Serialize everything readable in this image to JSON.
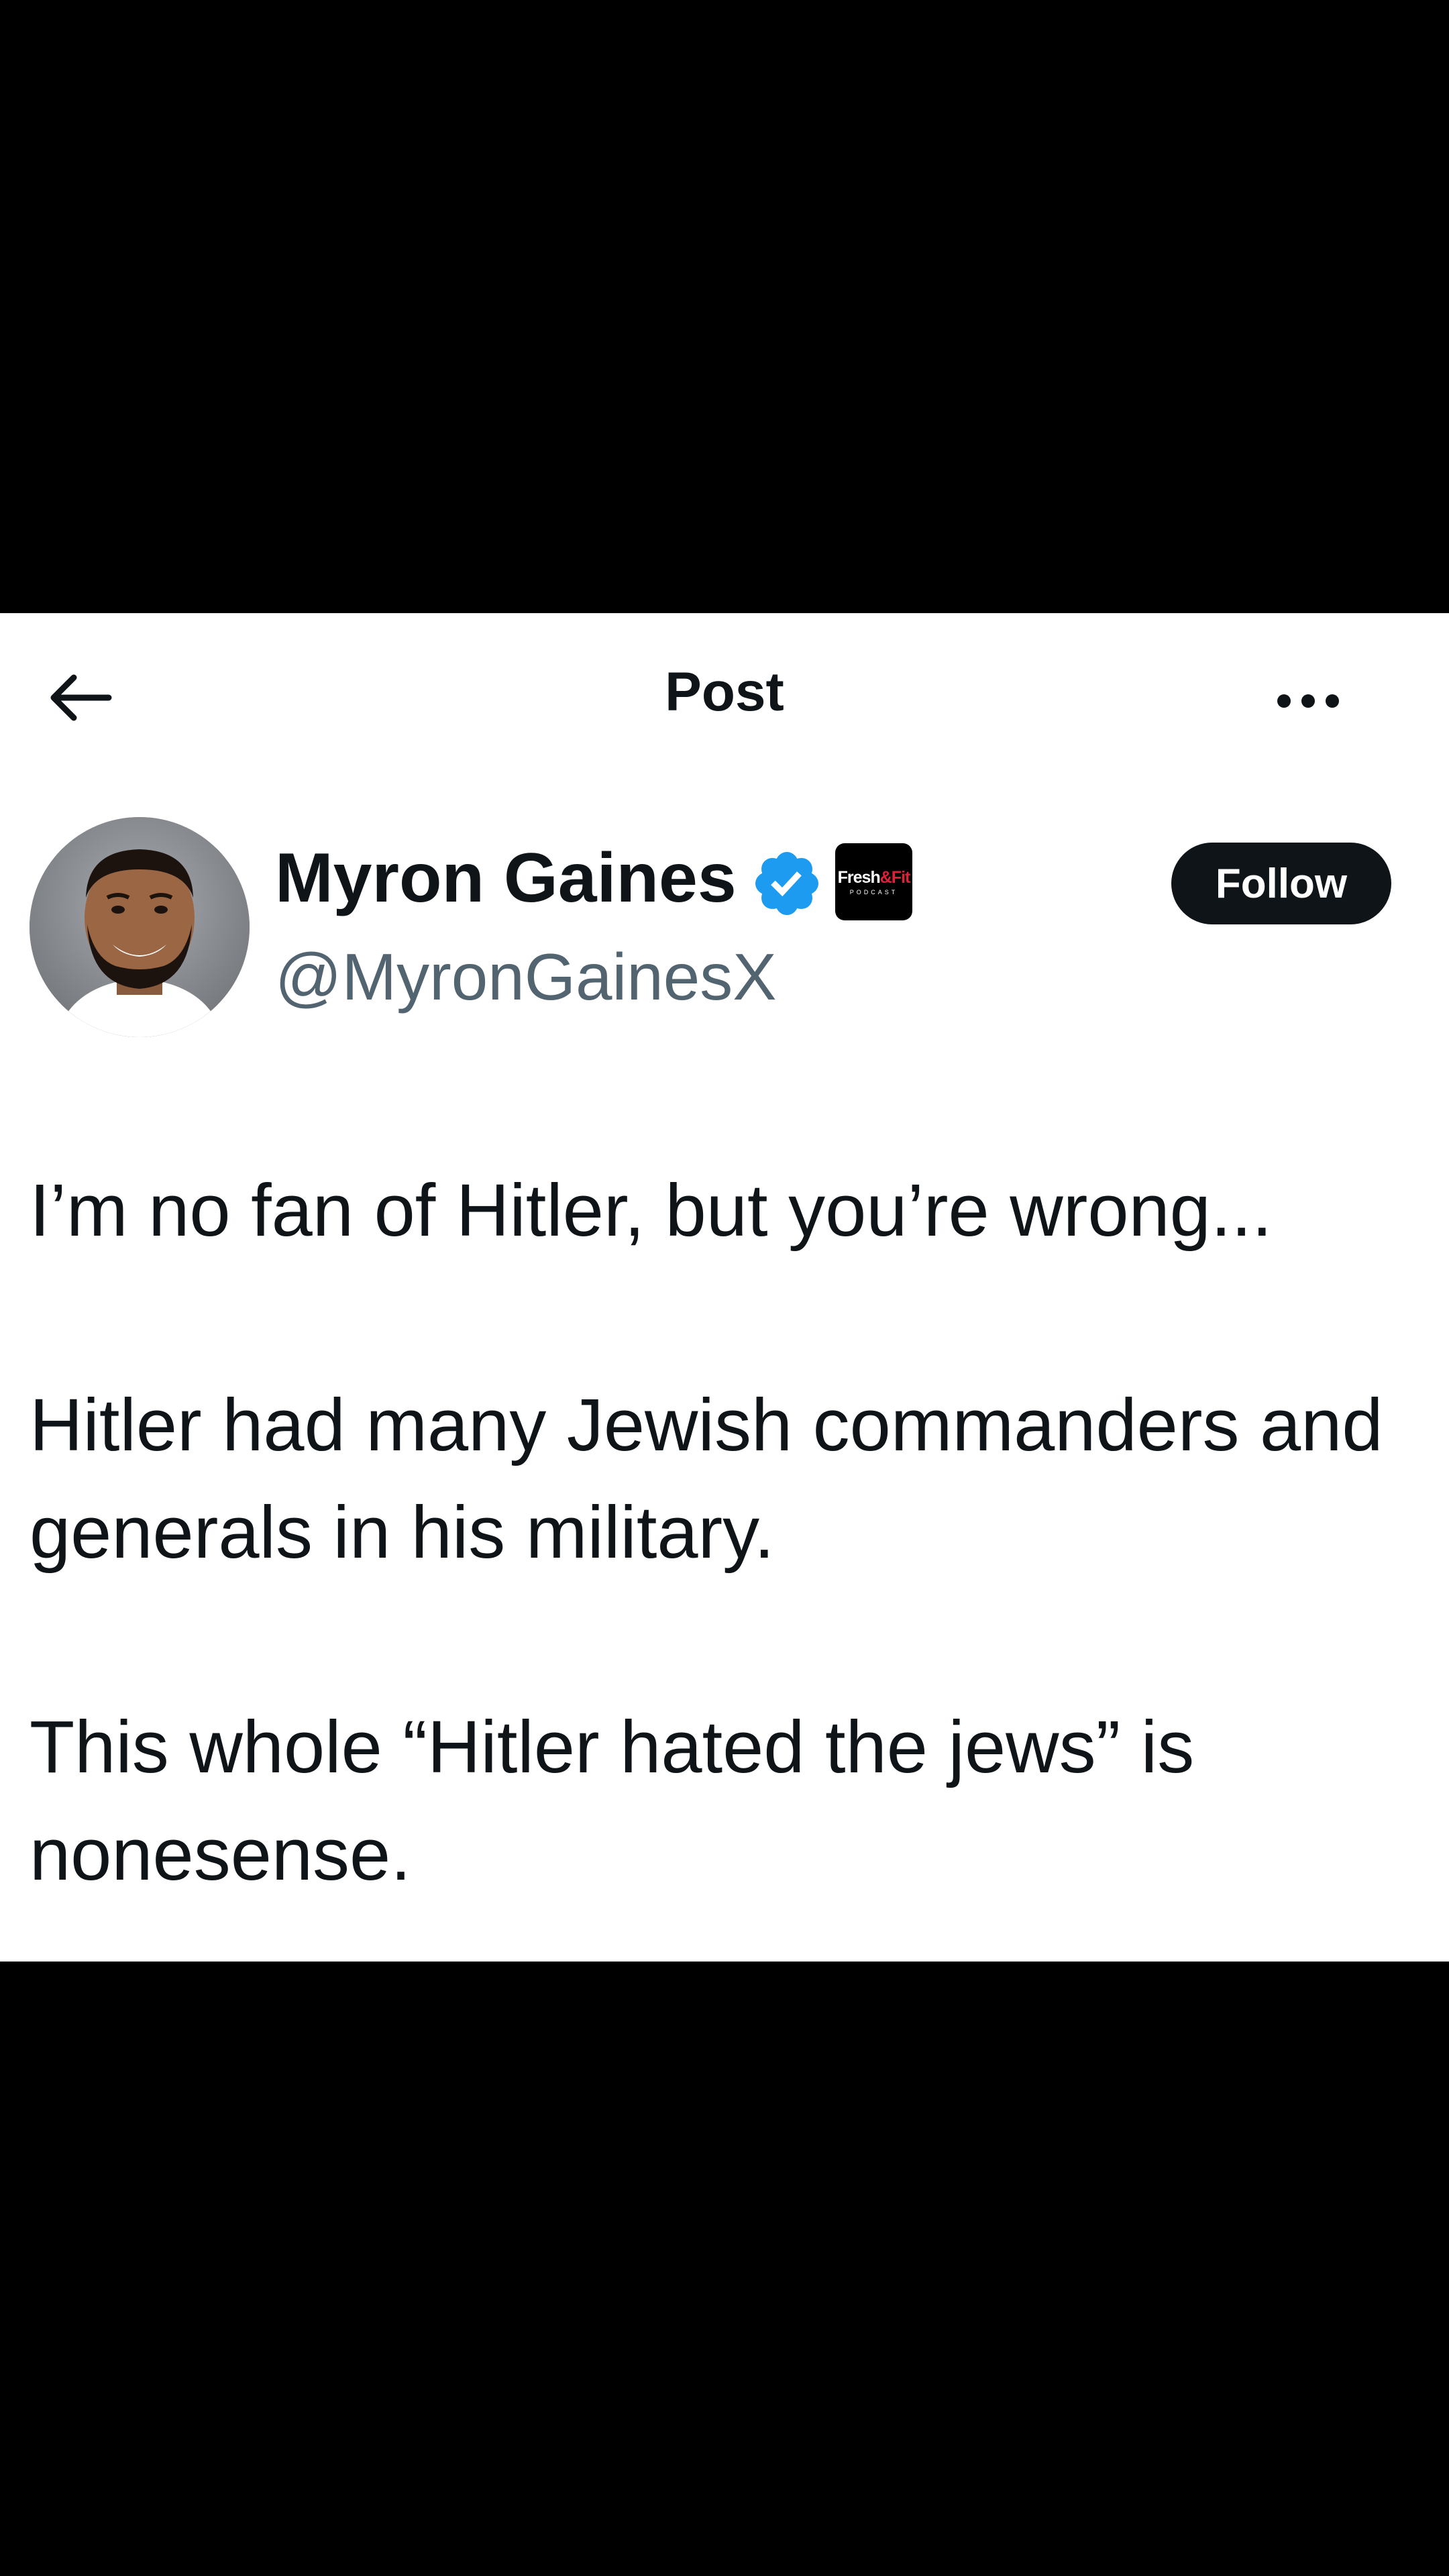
{
  "header": {
    "title": "Post",
    "back_icon": "arrow-left-icon",
    "more_icon": "more-horizontal-icon"
  },
  "author": {
    "display_name": "Myron Gaines",
    "handle": "@MyronGainesX",
    "verified_icon": "verified-badge-icon",
    "verified_color": "#1d9bf0",
    "affiliate_badge": {
      "text_main": "Fresh",
      "text_amp": "&",
      "text_red": "Fit",
      "text_sub": "PODCAST"
    },
    "follow_label": "Follow"
  },
  "post": {
    "paragraphs": [
      "I’m no fan of Hitler, but you’re wrong...",
      "Hitler had many Jewish commanders and generals in his military.",
      "This whole “Hitler hated the jews” is nonesense."
    ]
  },
  "colors": {
    "text_primary": "#0f1419",
    "text_secondary": "#536471",
    "background": "#ffffff",
    "letterbox": "#000000"
  }
}
